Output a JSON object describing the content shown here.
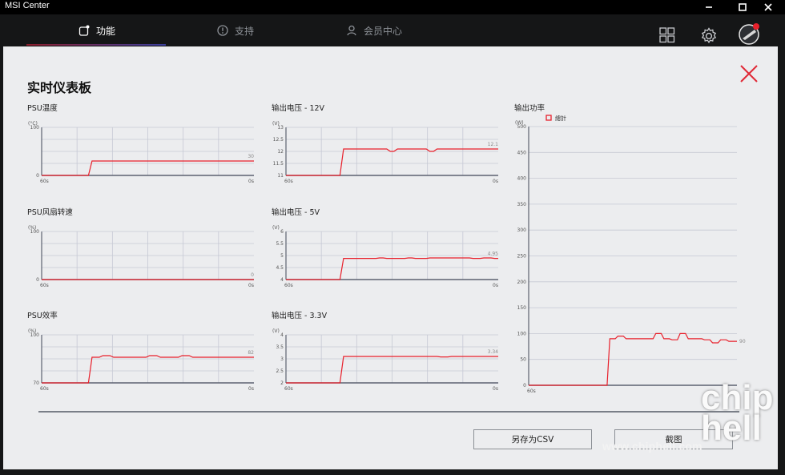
{
  "window": {
    "title": "MSI Center"
  },
  "nav": {
    "tabs": [
      {
        "label": "功能",
        "active": true
      },
      {
        "label": "支持",
        "active": false
      },
      {
        "label": "会员中心",
        "active": false
      }
    ]
  },
  "panel": {
    "title": "实时仪表板",
    "save_csv_label": "另存为CSV",
    "screenshot_label": "截图"
  },
  "watermark": {
    "site": "www.chiphell.com",
    "logo": "chip hell"
  },
  "colors": {
    "series": "#e8202b",
    "grid": "#c6c9d4",
    "frame": "#5d6270"
  },
  "chart_data": [
    {
      "id": "psu-temp",
      "type": "line",
      "title": "PSU温度",
      "unit": "(°C)",
      "yticks": [
        "100",
        "0"
      ],
      "ylim": [
        0,
        100
      ],
      "x_start": "60s",
      "x_end": "0s",
      "value_label": "30",
      "values": [
        0,
        0,
        0,
        0,
        0,
        0,
        0,
        0,
        0,
        0,
        0,
        0,
        0,
        0,
        30,
        30,
        30,
        30,
        30,
        30,
        30,
        30,
        30,
        30,
        30,
        30,
        30,
        30,
        30,
        30,
        30,
        30,
        30,
        30,
        30,
        30,
        30,
        30,
        30,
        30,
        30,
        30,
        30,
        30,
        30,
        30,
        30,
        30,
        30,
        30,
        30,
        30,
        30,
        30,
        30,
        30,
        30,
        30,
        30,
        30
      ]
    },
    {
      "id": "out-12v",
      "type": "line",
      "title": "输出电压 - 12V",
      "unit": "(V)",
      "yticks": [
        "13",
        "12.5",
        "12",
        "11.5",
        "11"
      ],
      "ylim": [
        11,
        13
      ],
      "x_start": "60s",
      "x_end": "0s",
      "value_label": "12.1",
      "values": [
        11,
        11,
        11,
        11,
        11,
        11,
        11,
        11,
        11,
        11,
        11,
        11,
        11,
        11,
        11,
        11,
        12.1,
        12.1,
        12.1,
        12.1,
        12.1,
        12.1,
        12.1,
        12.1,
        12.1,
        12.1,
        12.1,
        12.1,
        12.1,
        12.0,
        12.0,
        12.1,
        12.1,
        12.1,
        12.1,
        12.1,
        12.1,
        12.1,
        12.1,
        12.1,
        12.0,
        12.0,
        12.1,
        12.1,
        12.1,
        12.1,
        12.1,
        12.1,
        12.1,
        12.1,
        12.1,
        12.1,
        12.1,
        12.1,
        12.1,
        12.1,
        12.1,
        12.1,
        12.1,
        12.1
      ]
    },
    {
      "id": "fan-speed",
      "type": "line",
      "title": "PSU风扇转速",
      "unit": "(%)",
      "yticks": [
        "100",
        "0"
      ],
      "ylim": [
        0,
        100
      ],
      "x_start": "60s",
      "x_end": "0s",
      "value_label": "0",
      "values": [
        0,
        0,
        0,
        0,
        0,
        0,
        0,
        0,
        0,
        0,
        0,
        0,
        0,
        0,
        0,
        0,
        0,
        0,
        0,
        0,
        0,
        0,
        0,
        0,
        0,
        0,
        0,
        0,
        0,
        0,
        0,
        0,
        0,
        0,
        0,
        0,
        0,
        0,
        0,
        0,
        0,
        0,
        0,
        0,
        0,
        0,
        0,
        0,
        0,
        0,
        0,
        0,
        0,
        0,
        0,
        0,
        0,
        0,
        0,
        0
      ]
    },
    {
      "id": "out-5v",
      "type": "line",
      "title": "输出电压  - 5V",
      "unit": "(V)",
      "yticks": [
        "6",
        "5.5",
        "5",
        "4.5",
        "4"
      ],
      "ylim": [
        4,
        6
      ],
      "x_start": "60s",
      "x_end": "0s",
      "value_label": "4.95",
      "values": [
        4,
        4,
        4,
        4,
        4,
        4,
        4,
        4,
        4,
        4,
        4,
        4,
        4,
        4,
        4,
        4,
        4.88,
        4.88,
        4.88,
        4.88,
        4.88,
        4.88,
        4.88,
        4.88,
        4.88,
        4.88,
        4.9,
        4.9,
        4.88,
        4.88,
        4.88,
        4.88,
        4.88,
        4.88,
        4.9,
        4.9,
        4.88,
        4.88,
        4.88,
        4.88,
        4.9,
        4.9,
        4.9,
        4.9,
        4.9,
        4.9,
        4.9,
        4.9,
        4.9,
        4.9,
        4.9,
        4.9,
        4.88,
        4.88,
        4.88,
        4.9,
        4.9,
        4.9,
        4.88,
        4.88
      ]
    },
    {
      "id": "psu-eff",
      "type": "line",
      "title": "PSU效率",
      "unit": "(%)",
      "yticks": [
        "100",
        "70"
      ],
      "ylim": [
        70,
        100
      ],
      "x_start": "60s",
      "x_end": "0s",
      "value_label": "82",
      "values": [
        70,
        70,
        70,
        70,
        70,
        70,
        70,
        70,
        70,
        70,
        70,
        70,
        70,
        70,
        86,
        86,
        86,
        87,
        87,
        87,
        86,
        86,
        86,
        86,
        86,
        86,
        86,
        86,
        86,
        86,
        87,
        87,
        87,
        86,
        86,
        86,
        86,
        86,
        86,
        87,
        87,
        87,
        86,
        86,
        86,
        86,
        86,
        86,
        86,
        86,
        86,
        86,
        86,
        86,
        86,
        86,
        86,
        86,
        86,
        86
      ]
    },
    {
      "id": "out-33v",
      "type": "line",
      "title": "输出电压  - 3.3V",
      "unit": "(V)",
      "yticks": [
        "4",
        "3.5",
        "3",
        "2.5",
        "2"
      ],
      "ylim": [
        2,
        4
      ],
      "x_start": "60s",
      "x_end": "0s",
      "value_label": "3.34",
      "values": [
        2,
        2,
        2,
        2,
        2,
        2,
        2,
        2,
        2,
        2,
        2,
        2,
        2,
        2,
        2,
        2,
        3.1,
        3.1,
        3.1,
        3.1,
        3.1,
        3.1,
        3.1,
        3.1,
        3.1,
        3.1,
        3.1,
        3.1,
        3.1,
        3.1,
        3.1,
        3.1,
        3.1,
        3.1,
        3.1,
        3.1,
        3.1,
        3.1,
        3.1,
        3.1,
        3.1,
        3.1,
        3.1,
        3.08,
        3.08,
        3.08,
        3.1,
        3.1,
        3.1,
        3.1,
        3.1,
        3.1,
        3.1,
        3.1,
        3.1,
        3.1,
        3.1,
        3.1,
        3.1,
        3.1
      ]
    },
    {
      "id": "out-power",
      "type": "line",
      "title": "输出功率",
      "unit": "(W)",
      "legend": "總計",
      "yticks": [
        "500",
        "450",
        "400",
        "350",
        "300",
        "250",
        "200",
        "150",
        "100",
        "50",
        "0"
      ],
      "ylim": [
        0,
        500
      ],
      "x_start": "60s",
      "x_end": "",
      "value_label": "90",
      "values": [
        0,
        0,
        0,
        0,
        0,
        0,
        0,
        0,
        0,
        0,
        0,
        0,
        0,
        0,
        0,
        0,
        0,
        0,
        0,
        0,
        0,
        0,
        0,
        0,
        0,
        0,
        0,
        0,
        0,
        0,
        90,
        90,
        90,
        95,
        95,
        95,
        90,
        90,
        90,
        90,
        90,
        90,
        90,
        90,
        90,
        90,
        90,
        100,
        100,
        100,
        90,
        90,
        90,
        88,
        88,
        88,
        100,
        100,
        100,
        90,
        90,
        90,
        90,
        90,
        90,
        88,
        88,
        88,
        82,
        82,
        82,
        88,
        88,
        88,
        85,
        85,
        85,
        85
      ]
    }
  ]
}
